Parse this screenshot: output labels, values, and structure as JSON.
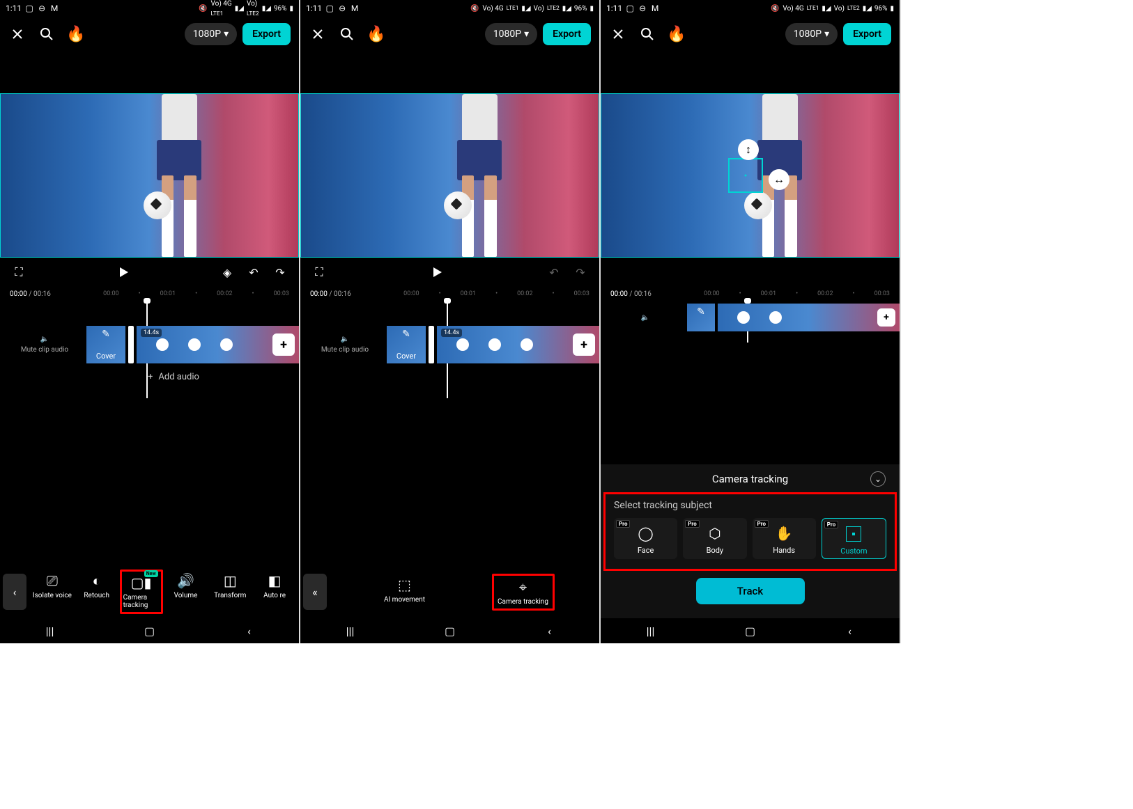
{
  "status": {
    "time": "1:11",
    "net1": "Vo) 4G",
    "sub1": "LTE1",
    "net2": "Vo)",
    "sub2": "LTE2",
    "battery": "96%"
  },
  "appbar": {
    "resolution": "1080P",
    "export": "Export"
  },
  "player_controls": {
    "time_current": "00:00",
    "time_total": "00:16"
  },
  "timeline": {
    "ticks": [
      "00:00",
      "00:01",
      "00:02",
      "00:03"
    ],
    "clip_duration": "14.4s",
    "mute_label": "Mute clip audio",
    "cover_label": "Cover",
    "add_audio": "Add audio"
  },
  "tools_p1": {
    "back": "<",
    "items": [
      {
        "label": "Isolate voice"
      },
      {
        "label": "Retouch"
      },
      {
        "label": "Camera tracking",
        "badge": "New"
      },
      {
        "label": "Volume"
      },
      {
        "label": "Transform"
      },
      {
        "label": "Auto re"
      }
    ]
  },
  "tools_p2": {
    "ai_movement": "AI movement",
    "camera_tracking": "Camera tracking"
  },
  "tracking_panel": {
    "title": "Camera tracking",
    "subject_label": "Select tracking subject",
    "subjects": {
      "face": "Face",
      "body": "Body",
      "hands": "Hands",
      "custom": "Custom"
    },
    "pro": "Pro",
    "track_btn": "Track"
  }
}
